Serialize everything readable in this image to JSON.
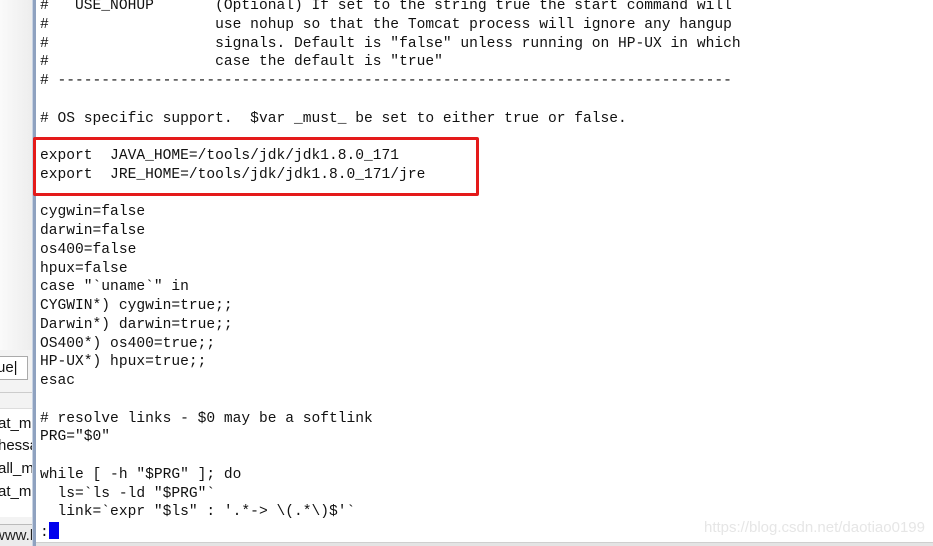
{
  "left_panel": {
    "tab_label": "ue|",
    "list_items": [
      "at_m",
      "hessa",
      "all_m",
      "at_m"
    ],
    "status_text": "www.k"
  },
  "terminal": {
    "lines": [
      "#   USE_NOHUP       (Optional) If set to the string true the start command will",
      "#                   use nohup so that the Tomcat process will ignore any hangup",
      "#                   signals. Default is \"false\" unless running on HP-UX in which",
      "#                   case the default is \"true\"",
      "# -----------------------------------------------------------------------------",
      "",
      "# OS specific support.  $var _must_ be set to either true or false.",
      "",
      "export  JAVA_HOME=/tools/jdk/jdk1.8.0_171",
      "export  JRE_HOME=/tools/jdk/jdk1.8.0_171/jre",
      "",
      "cygwin=false",
      "darwin=false",
      "os400=false",
      "hpux=false",
      "case \"`uname`\" in",
      "CYGWIN*) cygwin=true;;",
      "Darwin*) darwin=true;;",
      "OS400*) os400=true;;",
      "HP-UX*) hpux=true;;",
      "esac",
      "",
      "# resolve links - $0 may be a softlink",
      "PRG=\"$0\"",
      "",
      "while [ -h \"$PRG\" ]; do",
      "  ls=`ls -ld \"$PRG\"`",
      "  link=`expr \"$ls\" : '.*-> \\(.*\\)$'`"
    ],
    "prompt": ":",
    "cursor_color": "#0000ee",
    "highlight_color": "#e41a1a"
  },
  "watermark": "https://blog.csdn.net/daotiao0199"
}
